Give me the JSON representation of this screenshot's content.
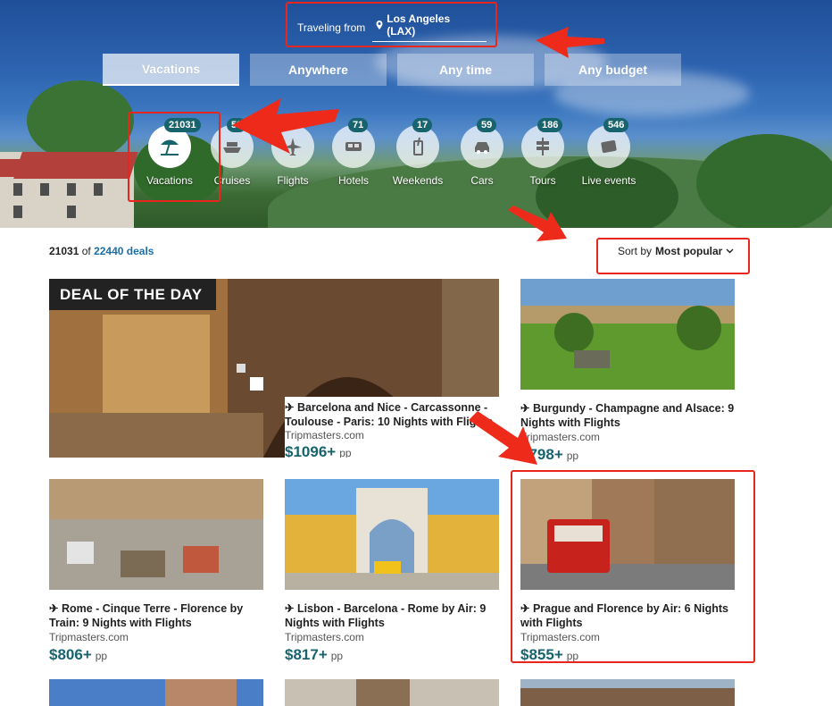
{
  "travel": {
    "label": "Traveling from",
    "location": "Los Angeles (LAX)"
  },
  "filters": [
    {
      "label": "Vacations"
    },
    {
      "label": "Anywhere"
    },
    {
      "label": "Any time"
    },
    {
      "label": "Any budget"
    }
  ],
  "categories": [
    {
      "label": "Vacations",
      "count": "21031",
      "icon": "beach-umbrella-icon"
    },
    {
      "label": "Cruises",
      "count": "52",
      "icon": "ship-icon"
    },
    {
      "label": "Flights",
      "count": "",
      "icon": "airplane-icon"
    },
    {
      "label": "Hotels",
      "count": "71",
      "icon": "bed-icon"
    },
    {
      "label": "Weekends",
      "count": "17",
      "icon": "drink-icon"
    },
    {
      "label": "Cars",
      "count": "59",
      "icon": "car-icon"
    },
    {
      "label": "Tours",
      "count": "186",
      "icon": "signpost-icon"
    },
    {
      "label": "Live events",
      "count": "546",
      "icon": "ticket-icon"
    }
  ],
  "results": {
    "shown": "21031",
    "of": "of",
    "total": "22440 deals",
    "sort_label": "Sort by",
    "sort_value": "Most popular"
  },
  "deal_of_day": {
    "banner": "DEAL OF THE DAY",
    "title": "✈ Barcelona and Nice - Carcassonne - Toulouse - Paris: 10 Nights with Flights",
    "source": "Tripmasters.com",
    "price": "$1096+",
    "pp": "pp"
  },
  "cards": [
    {
      "title": "✈ Burgundy - Champagne and Alsace: 9 Nights with Flights",
      "source": "Tripmasters.com",
      "price": "$798+",
      "pp": "pp"
    },
    {
      "title": "✈ Rome - Cinque Terre - Florence by Train: 9 Nights with Flights",
      "source": "Tripmasters.com",
      "price": "$806+",
      "pp": "pp"
    },
    {
      "title": "✈ Lisbon - Barcelona - Rome by Air: 9 Nights with Flights",
      "source": "Tripmasters.com",
      "price": "$817+",
      "pp": "pp"
    },
    {
      "title": "✈ Prague and Florence by Air: 6 Nights with Flights",
      "source": "Tripmasters.com",
      "price": "$855+",
      "pp": "pp"
    }
  ]
}
